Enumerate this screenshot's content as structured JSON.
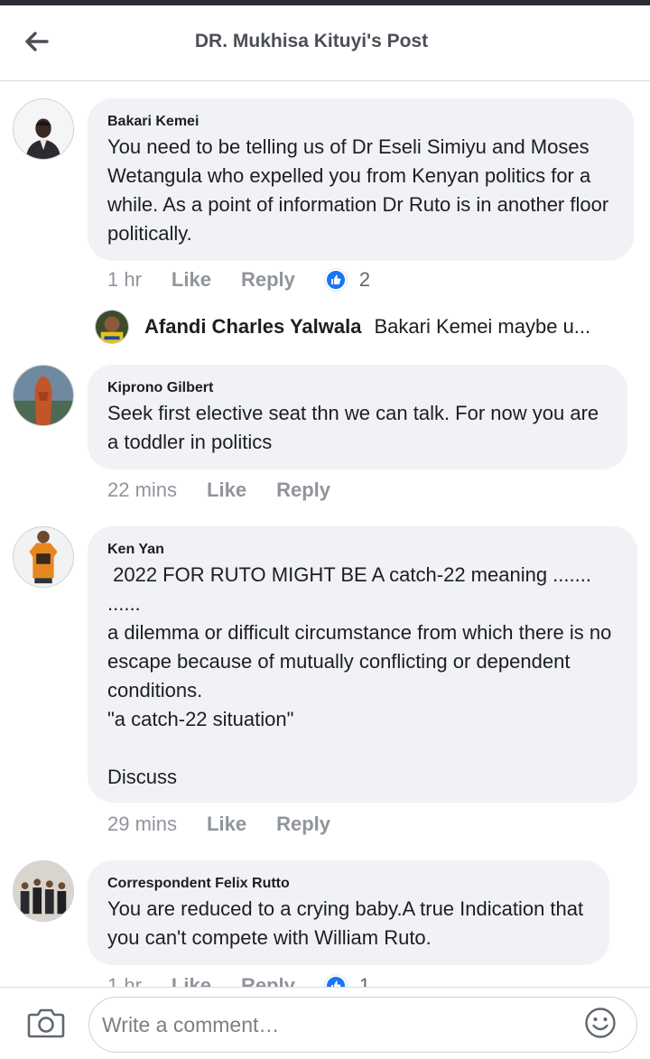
{
  "header": {
    "title": "DR. Mukhisa Kituyi's Post",
    "back_icon": "arrow-left-icon"
  },
  "comments": [
    {
      "author": "Bakari Kemei",
      "text": "You need to be telling us of Dr Eseli Simiyu and Moses Wetangula who expelled you from Kenyan politics for a while. As a point of information Dr Ruto is in another floor politically.",
      "time": "1 hr",
      "like_label": "Like",
      "reply_label": "Reply",
      "reaction_icon": "thumbs-up-icon",
      "reaction_count": "2"
    },
    {
      "author": "Kiprono Gilbert",
      "text": "Seek first elective seat thn we can talk. For now you are a toddler in politics",
      "time": "22 mins",
      "like_label": "Like",
      "reply_label": "Reply"
    },
    {
      "author": "Ken Yan",
      "text": " 2022 FOR RUTO MIGHT BE A catch-22 meaning .......\n......\na dilemma or difficult circumstance from which there is no escape because of mutually conflicting or dependent conditions.\n\"a catch-22 situation\"\n\nDiscuss",
      "time": "29 mins",
      "like_label": "Like",
      "reply_label": "Reply"
    },
    {
      "author": "Correspondent Felix Rutto",
      "text": "You are reduced to a crying baby.A true Indication that you can't compete with William Ruto.",
      "time": "1 hr",
      "like_label": "Like",
      "reply_label": "Reply",
      "reaction_icon": "thumbs-up-icon",
      "reaction_count": "1"
    }
  ],
  "reply_preview": {
    "author": "Afandi Charles Yalwala",
    "text": "Bakari Kemei maybe u..."
  },
  "composer": {
    "placeholder": "Write a comment…",
    "camera_icon": "camera-icon",
    "emoji_icon": "smiley-icon"
  },
  "colors": {
    "bubble": "#f0f2f5",
    "meta_text": "#90949c",
    "like_blue": "#1877f2"
  }
}
